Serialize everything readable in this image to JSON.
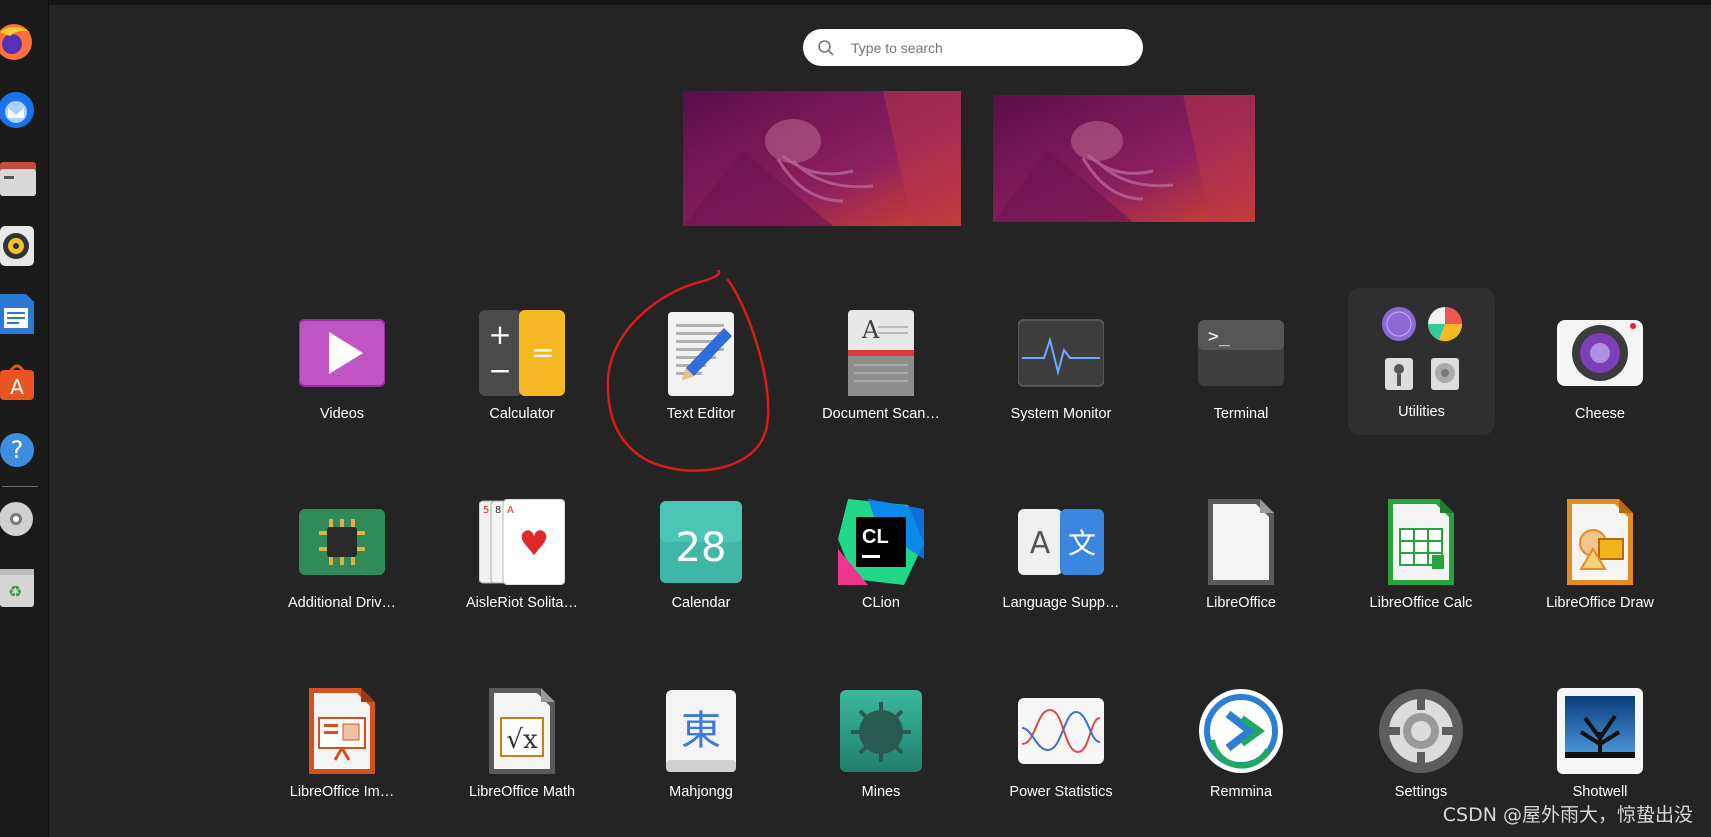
{
  "search": {
    "placeholder": "Type to search"
  },
  "dock": {
    "items": [
      {
        "name": "firefox-icon"
      },
      {
        "name": "thunderbird-icon"
      },
      {
        "name": "files-icon"
      },
      {
        "name": "rhythmbox-icon"
      },
      {
        "name": "libreoffice-writer-icon"
      },
      {
        "name": "app-center-icon"
      },
      {
        "name": "help-icon"
      },
      {
        "name": "disc-icon"
      },
      {
        "name": "trash-icon"
      }
    ]
  },
  "apps": [
    {
      "label": "Videos",
      "icon": "videos-icon"
    },
    {
      "label": "Calculator",
      "icon": "calculator-icon"
    },
    {
      "label": "Text Editor",
      "icon": "text-editor-icon"
    },
    {
      "label": "Document Scan…",
      "icon": "document-scanner-icon"
    },
    {
      "label": "System Monitor",
      "icon": "system-monitor-icon"
    },
    {
      "label": "Terminal",
      "icon": "terminal-icon"
    },
    {
      "label": "Utilities",
      "icon": "utilities-folder-icon"
    },
    {
      "label": "Cheese",
      "icon": "cheese-icon"
    },
    {
      "label": "Additional Driv…",
      "icon": "additional-drivers-icon"
    },
    {
      "label": "AisleRiot Solita…",
      "icon": "aisleriot-icon"
    },
    {
      "label": "Calendar",
      "icon": "calendar-icon",
      "text": "28"
    },
    {
      "label": "CLion",
      "icon": "clion-icon",
      "text": "CL"
    },
    {
      "label": "Language Supp…",
      "icon": "language-support-icon",
      "text": "A",
      "text2": "文"
    },
    {
      "label": "LibreOffice",
      "icon": "libreoffice-icon"
    },
    {
      "label": "LibreOffice Calc",
      "icon": "libreoffice-calc-icon"
    },
    {
      "label": "LibreOffice Draw",
      "icon": "libreoffice-draw-icon"
    },
    {
      "label": "LibreOffice Im…",
      "icon": "libreoffice-impress-icon"
    },
    {
      "label": "LibreOffice Math",
      "icon": "libreoffice-math-icon"
    },
    {
      "label": "Mahjongg",
      "icon": "mahjongg-icon",
      "text": "東"
    },
    {
      "label": "Mines",
      "icon": "mines-icon"
    },
    {
      "label": "Power Statistics",
      "icon": "power-statistics-icon"
    },
    {
      "label": "Remmina",
      "icon": "remmina-icon"
    },
    {
      "label": "Settings",
      "icon": "settings-icon"
    },
    {
      "label": "Shotwell",
      "icon": "shotwell-icon"
    }
  ],
  "watermark": "CSDN @屋外雨大，惊蛰出没",
  "colors": {
    "background": "#242424",
    "annotation": "#d81b1b",
    "accent": "#e95420"
  }
}
